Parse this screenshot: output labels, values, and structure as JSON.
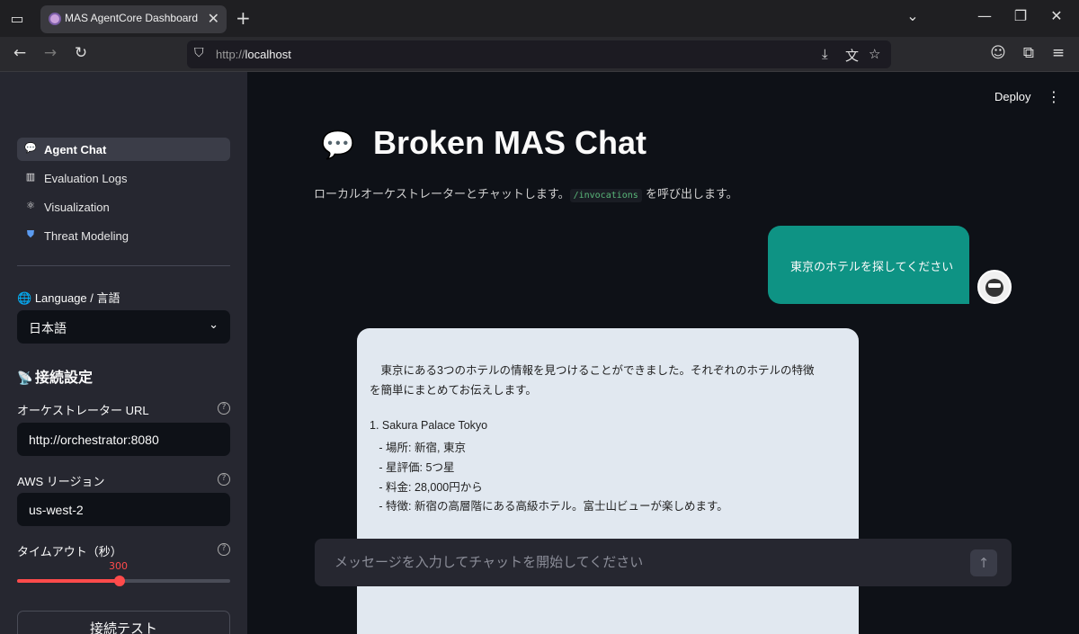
{
  "browser": {
    "tab_title": "MAS AgentCore Dashboard",
    "url_protocol": "http://",
    "url_host": "localhost"
  },
  "sidebar": {
    "nav": [
      {
        "label": "Agent Chat",
        "icon": "speech-bubble-icon",
        "active": true
      },
      {
        "label": "Evaluation Logs",
        "icon": "bar-chart-icon",
        "active": false
      },
      {
        "label": "Visualization",
        "icon": "atom-icon",
        "active": false
      },
      {
        "label": "Threat Modeling",
        "icon": "shield-icon",
        "active": false
      }
    ],
    "language_label": "Language / 言語",
    "language_value": "日本語",
    "connection_heading": "接続設定",
    "orchestrator_label": "オーケストレーター URL",
    "orchestrator_value": "http://orchestrator:8080",
    "region_label": "AWS リージョン",
    "region_value": "us-west-2",
    "timeout_label": "タイムアウト（秒）",
    "timeout_value": "300",
    "timeout_fraction": 0.48,
    "test_button": "接続テスト"
  },
  "main": {
    "deploy": "Deploy",
    "title": "Broken MAS Chat",
    "caption_prefix": "ローカルオーケストレーターとチャットします。",
    "caption_code": "/invocations",
    "caption_suffix": "を呼び出します。",
    "user_message": "東京のホテルを探してください",
    "bot_lines": [
      "　東京にある3つのホテルの情報を見つけることができました。それぞれのホテルの特徴",
      "を簡単にまとめてお伝えします。",
      "",
      "1. Sakura Palace Tokyo",
      "   - 場所: 新宿, 東京",
      "   - 星評価: 5つ星",
      "   - 料金: 28,000円から",
      "   - 特徴: 新宿の高層階にある高級ホテル。富士山ビューが楽しめます。"
    ],
    "chat_placeholder": "メッセージを入力してチャットを開始してください"
  }
}
